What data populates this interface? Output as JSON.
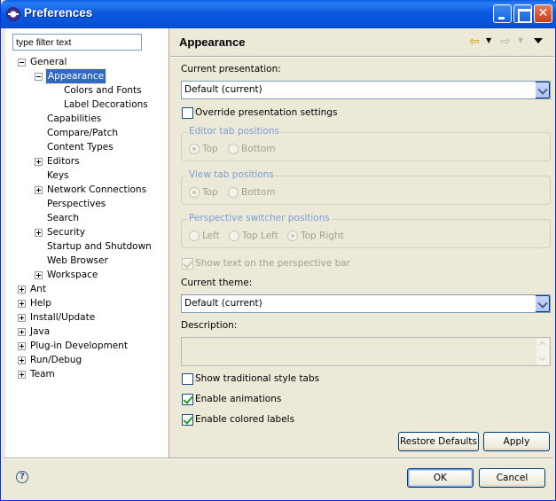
{
  "window": {
    "title": "Preferences"
  },
  "filter": {
    "placeholder": "type filter text"
  },
  "tree": [
    {
      "label": "General",
      "expander": "minus",
      "level": 0
    },
    {
      "label": "Appearance",
      "expander": "minus",
      "level": 1,
      "selected": true
    },
    {
      "label": "Colors and Fonts",
      "expander": "none",
      "level": 2
    },
    {
      "label": "Label Decorations",
      "expander": "none",
      "level": 2
    },
    {
      "label": "Capabilities",
      "expander": "none",
      "level": 1
    },
    {
      "label": "Compare/Patch",
      "expander": "none",
      "level": 1
    },
    {
      "label": "Content Types",
      "expander": "none",
      "level": 1
    },
    {
      "label": "Editors",
      "expander": "plus",
      "level": 1
    },
    {
      "label": "Keys",
      "expander": "none",
      "level": 1
    },
    {
      "label": "Network Connections",
      "expander": "plus",
      "level": 1
    },
    {
      "label": "Perspectives",
      "expander": "none",
      "level": 1
    },
    {
      "label": "Search",
      "expander": "none",
      "level": 1
    },
    {
      "label": "Security",
      "expander": "plus",
      "level": 1
    },
    {
      "label": "Startup and Shutdown",
      "expander": "none",
      "level": 1
    },
    {
      "label": "Web Browser",
      "expander": "none",
      "level": 1
    },
    {
      "label": "Workspace",
      "expander": "plus",
      "level": 1
    },
    {
      "label": "Ant",
      "expander": "plus",
      "level": 0
    },
    {
      "label": "Help",
      "expander": "plus",
      "level": 0
    },
    {
      "label": "Install/Update",
      "expander": "plus",
      "level": 0
    },
    {
      "label": "Java",
      "expander": "plus",
      "level": 0
    },
    {
      "label": "Plug-in Development",
      "expander": "plus",
      "level": 0
    },
    {
      "label": "Run/Debug",
      "expander": "plus",
      "level": 0
    },
    {
      "label": "Team",
      "expander": "plus",
      "level": 0
    }
  ],
  "page": {
    "title": "Appearance",
    "current_presentation_label": "Current presentation:",
    "current_presentation_value": "Default (current)",
    "override_label": "Override presentation settings",
    "editor_tab_group": {
      "label": "Editor tab positions",
      "options": [
        "Top",
        "Bottom"
      ],
      "selected": "Top"
    },
    "view_tab_group": {
      "label": "View tab positions",
      "options": [
        "Top",
        "Bottom"
      ],
      "selected": "Top"
    },
    "perspective_group": {
      "label": "Perspective switcher positions",
      "options": [
        "Left",
        "Top Left",
        "Top Right"
      ],
      "selected": "Top Right"
    },
    "show_text_label": "Show text on the perspective bar",
    "current_theme_label": "Current theme:",
    "current_theme_value": "Default (current)",
    "description_label": "Description:",
    "traditional_tabs_label": "Show traditional style tabs",
    "animations_label": "Enable animations",
    "colored_labels_label": "Enable colored labels",
    "restore_defaults": "Restore Defaults",
    "apply": "Apply"
  },
  "dialog": {
    "ok": "OK",
    "cancel": "Cancel"
  },
  "icons": {
    "app": "eclipse-icon",
    "help": "help-icon",
    "back": "back-arrow-icon",
    "forward": "forward-arrow-icon",
    "menu": "view-menu-icon"
  },
  "colors": {
    "selection": "#316ac5",
    "title_bar": "#0550d8",
    "group_label": "#7b9ed8"
  }
}
